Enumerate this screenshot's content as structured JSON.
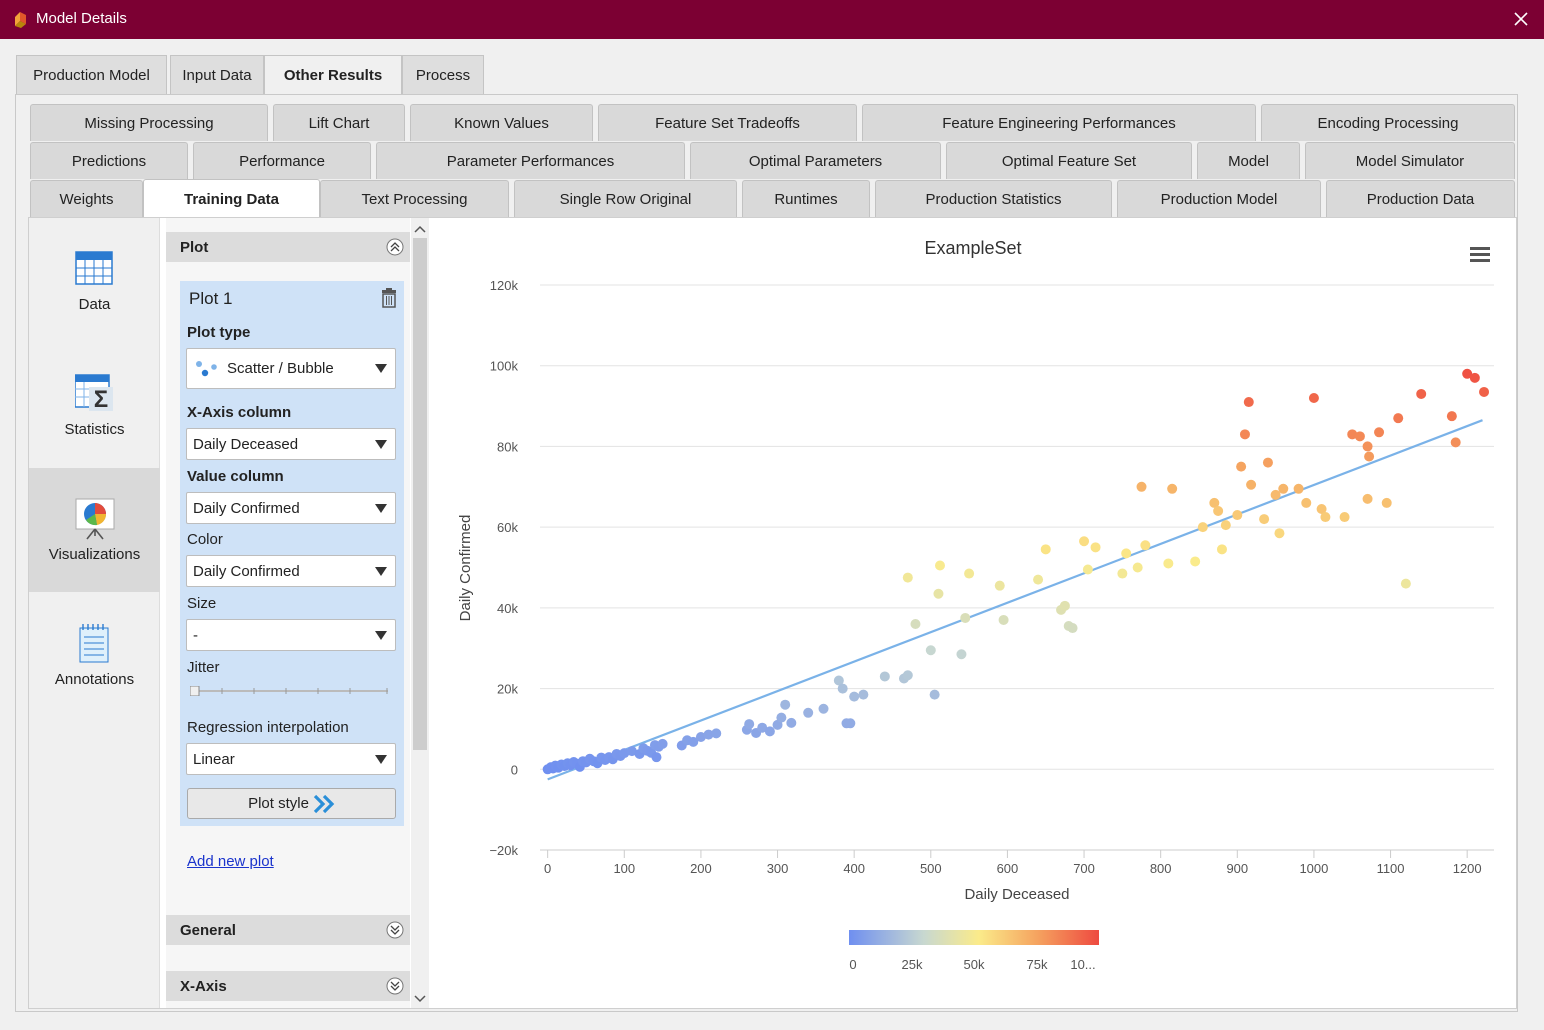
{
  "window": {
    "title": "Model Details"
  },
  "main_tabs": [
    {
      "label": "Production Model",
      "active": false
    },
    {
      "label": "Input Data",
      "active": false
    },
    {
      "label": "Other Results",
      "active": true
    },
    {
      "label": "Process",
      "active": false
    }
  ],
  "sub_tabs": {
    "row1": [
      "Missing Processing",
      "Lift Chart",
      "Known Values",
      "Feature Set Tradeoffs",
      "Feature Engineering Performances",
      "Encoding Processing"
    ],
    "row2": [
      "Predictions",
      "Performance",
      "Parameter Performances",
      "Optimal Parameters",
      "Optimal Feature Set",
      "Model",
      "Model Simulator"
    ],
    "row3": [
      "Weights",
      "Training Data",
      "Text Processing",
      "Single Row Original",
      "Runtimes",
      "Production Statistics",
      "Production Model",
      "Production Data"
    ],
    "active": "Training Data"
  },
  "left_nav": [
    {
      "label": "Data",
      "icon": "table-icon",
      "active": false
    },
    {
      "label": "Statistics",
      "icon": "sigma-table-icon",
      "active": false
    },
    {
      "label": "Visualizations",
      "icon": "presentation-chart-icon",
      "active": true
    },
    {
      "label": "Annotations",
      "icon": "notepad-icon",
      "active": false
    }
  ],
  "panel": {
    "plot_section": "Plot",
    "plot_name": "Plot 1",
    "plot_type_label": "Plot type",
    "plot_type_value": "Scatter / Bubble",
    "x_axis_label": "X-Axis column",
    "x_axis_value": "Daily Deceased",
    "value_column_label": "Value column",
    "value_column_value": "Daily Confirmed",
    "color_label": "Color",
    "color_value": "Daily Confirmed",
    "size_label": "Size",
    "size_value": "-",
    "jitter_label": "Jitter",
    "regression_label": "Regression interpolation",
    "regression_value": "Linear",
    "plot_style_button": "Plot style",
    "add_new_plot": "Add new plot",
    "general_section": "General",
    "xaxis_section": "X-Axis"
  },
  "chart_data": {
    "type": "scatter",
    "title": "ExampleSet",
    "xlabel": "Daily Deceased",
    "ylabel": "Daily Confirmed",
    "xlim": [
      -10,
      1235
    ],
    "ylim": [
      -20000,
      120000
    ],
    "xticks": [
      "0",
      "100",
      "200",
      "300",
      "400",
      "500",
      "600",
      "700",
      "800",
      "900",
      "1000",
      "1100",
      "1200"
    ],
    "yticks": [
      "−20k",
      "0",
      "20k",
      "40k",
      "60k",
      "80k",
      "100k",
      "120k"
    ],
    "grid": true,
    "regression": {
      "type": "linear",
      "x": [
        0,
        1220
      ],
      "y": [
        -2500,
        86500
      ]
    },
    "color_scale": {
      "labels": [
        "0",
        "25k",
        "50k",
        "75k",
        "10..."
      ],
      "min": 0,
      "max": 100000,
      "colors": [
        "#6f8ff0",
        "#c8d8d0",
        "#fbeb8a",
        "#f5a460",
        "#ee4a40"
      ]
    },
    "points": [
      [
        0,
        0
      ],
      [
        4,
        500
      ],
      [
        7,
        200
      ],
      [
        10,
        900
      ],
      [
        14,
        400
      ],
      [
        18,
        1200
      ],
      [
        22,
        800
      ],
      [
        26,
        1500
      ],
      [
        30,
        1000
      ],
      [
        34,
        1800
      ],
      [
        38,
        1400
      ],
      [
        42,
        600
      ],
      [
        46,
        2000
      ],
      [
        50,
        1700
      ],
      [
        55,
        2600
      ],
      [
        60,
        2000
      ],
      [
        65,
        1500
      ],
      [
        70,
        2900
      ],
      [
        75,
        2300
      ],
      [
        80,
        3000
      ],
      [
        85,
        2500
      ],
      [
        90,
        3800
      ],
      [
        95,
        3300
      ],
      [
        100,
        4000
      ],
      [
        110,
        4500
      ],
      [
        120,
        3800
      ],
      [
        125,
        5200
      ],
      [
        130,
        4600
      ],
      [
        135,
        4100
      ],
      [
        140,
        6000
      ],
      [
        145,
        5600
      ],
      [
        150,
        6300
      ],
      [
        142,
        3000
      ],
      [
        175,
        5900
      ],
      [
        182,
        7200
      ],
      [
        190,
        6800
      ],
      [
        200,
        8000
      ],
      [
        210,
        8600
      ],
      [
        220,
        8900
      ],
      [
        260,
        9800
      ],
      [
        263,
        11200
      ],
      [
        272,
        9000
      ],
      [
        280,
        10300
      ],
      [
        290,
        9400
      ],
      [
        300,
        11000
      ],
      [
        305,
        12800
      ],
      [
        310,
        16000
      ],
      [
        318,
        11500
      ],
      [
        340,
        14000
      ],
      [
        360,
        15000
      ],
      [
        380,
        22000
      ],
      [
        385,
        20000
      ],
      [
        390,
        11400
      ],
      [
        395,
        11400
      ],
      [
        400,
        18000
      ],
      [
        412,
        18500
      ],
      [
        440,
        23000
      ],
      [
        465,
        22500
      ],
      [
        470,
        23300
      ],
      [
        480,
        36000
      ],
      [
        500,
        29500
      ],
      [
        505,
        18500
      ],
      [
        510,
        43500
      ],
      [
        540,
        28500
      ],
      [
        545,
        37500
      ],
      [
        470,
        47500
      ],
      [
        512,
        50500
      ],
      [
        550,
        48500
      ],
      [
        590,
        45500
      ],
      [
        595,
        37000
      ],
      [
        640,
        47000
      ],
      [
        650,
        54500
      ],
      [
        670,
        39500
      ],
      [
        675,
        40500
      ],
      [
        680,
        35500
      ],
      [
        685,
        35000
      ],
      [
        700,
        56500
      ],
      [
        705,
        49500
      ],
      [
        715,
        55000
      ],
      [
        750,
        48500
      ],
      [
        755,
        53500
      ],
      [
        770,
        50000
      ],
      [
        780,
        55500
      ],
      [
        810,
        51000
      ],
      [
        845,
        51500
      ],
      [
        855,
        60000
      ],
      [
        870,
        66000
      ],
      [
        875,
        64000
      ],
      [
        880,
        54500
      ],
      [
        885,
        60500
      ],
      [
        900,
        63000
      ],
      [
        905,
        75000
      ],
      [
        910,
        83000
      ],
      [
        915,
        91000
      ],
      [
        918,
        70500
      ],
      [
        935,
        62000
      ],
      [
        940,
        76000
      ],
      [
        950,
        68000
      ],
      [
        955,
        58500
      ],
      [
        960,
        69500
      ],
      [
        980,
        69500
      ],
      [
        990,
        66000
      ],
      [
        1000,
        92000
      ],
      [
        1010,
        64500
      ],
      [
        1015,
        62500
      ],
      [
        1040,
        62500
      ],
      [
        1050,
        83000
      ],
      [
        1060,
        82500
      ],
      [
        1070,
        80000
      ],
      [
        1072,
        77500
      ],
      [
        1085,
        83500
      ],
      [
        1095,
        66000
      ],
      [
        1070,
        67000
      ],
      [
        1110,
        87000
      ],
      [
        1120,
        46000
      ],
      [
        1140,
        93000
      ],
      [
        1180,
        87500
      ],
      [
        1185,
        81000
      ],
      [
        1200,
        98000
      ],
      [
        1210,
        97000
      ],
      [
        1222,
        93500
      ],
      [
        775,
        70000
      ],
      [
        815,
        69500
      ]
    ]
  }
}
